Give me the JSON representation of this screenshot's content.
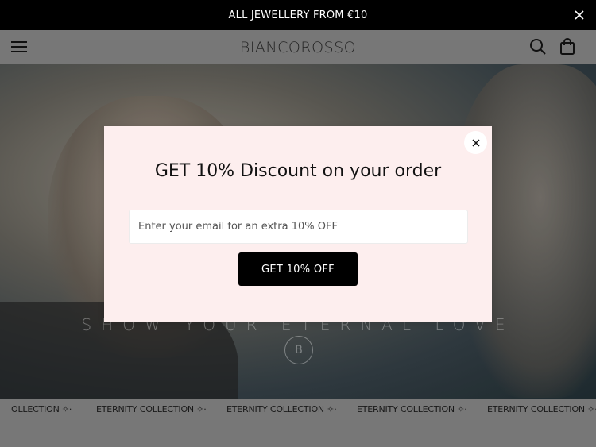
{
  "announcement": {
    "text": "ALL JEWELLERY FROM €10",
    "close_icon": "close-icon"
  },
  "header": {
    "logo": "BIANCOROSSO",
    "icons": {
      "menu": "hamburger-menu-icon",
      "search": "search-icon",
      "cart": "shopping-bag-icon"
    }
  },
  "hero": {
    "tagline": "SHOW YOUR ETERNAL LOVE",
    "monogram": "B"
  },
  "ticker": {
    "items": [
      "OLLECTION ✧·",
      "ETERNITY COLLECTION ✧·",
      "ETERNITY COLLECTION ✧·",
      "ETERNITY COLLECTION ✧·",
      "ETERNITY COLLECTION ✧·"
    ]
  },
  "popup": {
    "title": "GET 10% Discount on your order",
    "email_placeholder": "Enter your email for an extra 10% OFF",
    "email_value": "",
    "button_label": "GET 10% OFF",
    "close_icon": "close-icon",
    "background_color": "#fdeeee"
  }
}
